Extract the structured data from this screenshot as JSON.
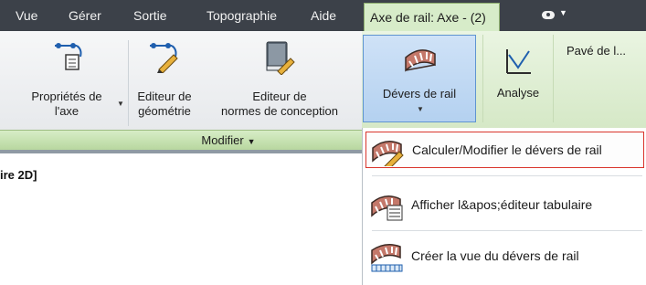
{
  "menubar": {
    "items": [
      "Vue",
      "Gérer",
      "Sortie",
      "Topographie",
      "Aide"
    ],
    "active_tab": "Axe de rail: Axe - (2)"
  },
  "ribbon": {
    "buttons": {
      "proprietes": [
        "Propriétés de",
        "l'axe"
      ],
      "editeur_geometrie": [
        "Editeur de",
        "géométrie"
      ],
      "editeur_normes": [
        "Editeur de",
        "normes de conception"
      ],
      "devers": "Dévers de rail",
      "analyse": "Analyse",
      "pave": "Pavé de l..."
    },
    "group_label": "Modifier"
  },
  "document": {
    "title_fragment": "ire 2D]"
  },
  "dropdown": {
    "items": [
      "Calculer/Modifier le dévers de rail",
      "Afficher l&apos;éditeur tabulaire",
      "Créer la vue du dévers de rail"
    ],
    "highlight_color": "#d9342b"
  },
  "icons": {
    "proprietes": "alignment-properties-icon",
    "geometrie": "geometry-editor-icon",
    "normes": "design-criteria-editor-icon",
    "devers": "rail-cant-icon",
    "analyse": "analysis-icon"
  }
}
